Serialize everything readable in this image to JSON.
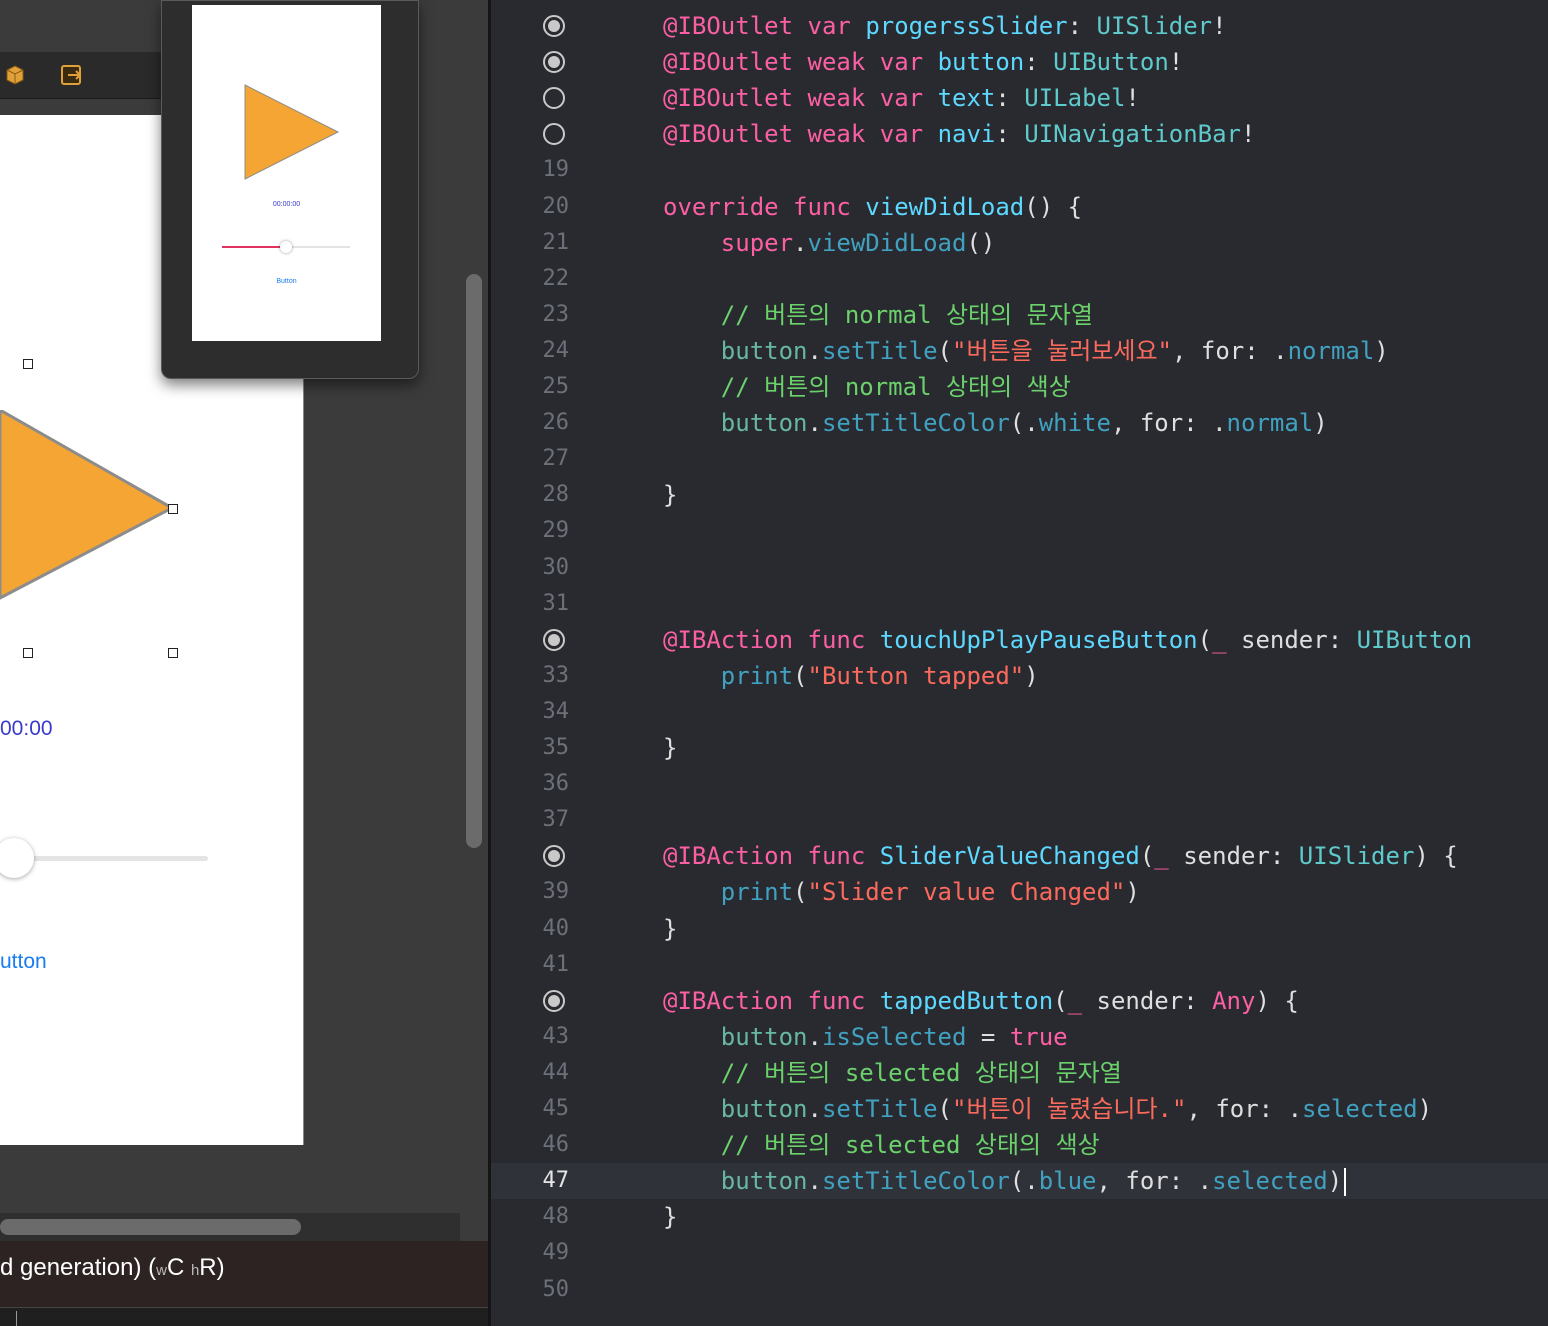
{
  "canvas": {
    "time_label": "00:00",
    "button_label": "utton",
    "mini_time": "00:00:00",
    "mini_button": "Button",
    "device_name": "d generation) (",
    "size_w_prefix": "w",
    "size_w": "C ",
    "size_h_prefix": "h",
    "size_h": "R)",
    "triangle_color": "#f4a534",
    "slider_min_color": "#e0335f",
    "slider_value": 0.5
  },
  "editor": {
    "current_line": "47",
    "lines": [
      {
        "num": "",
        "indicator": "filled",
        "tokens": [
          [
            "at",
            "@IBOutlet"
          ],
          [
            "pl",
            " "
          ],
          [
            "kw",
            "var"
          ],
          [
            "pl",
            " "
          ],
          [
            "decl",
            "progerssSlider"
          ],
          [
            "pl",
            ": "
          ],
          [
            "ty",
            "UISlider"
          ],
          [
            "pl",
            "!"
          ]
        ]
      },
      {
        "num": "",
        "indicator": "filled",
        "tokens": [
          [
            "at",
            "@IBOutlet"
          ],
          [
            "pl",
            " "
          ],
          [
            "kw",
            "weak"
          ],
          [
            "pl",
            " "
          ],
          [
            "kw",
            "var"
          ],
          [
            "pl",
            " "
          ],
          [
            "decl",
            "button"
          ],
          [
            "pl",
            ": "
          ],
          [
            "ty",
            "UIButton"
          ],
          [
            "pl",
            "!"
          ]
        ]
      },
      {
        "num": "",
        "indicator": "empty",
        "tokens": [
          [
            "at",
            "@IBOutlet"
          ],
          [
            "pl",
            " "
          ],
          [
            "kw",
            "weak"
          ],
          [
            "pl",
            " "
          ],
          [
            "kw",
            "var"
          ],
          [
            "pl",
            " "
          ],
          [
            "decl",
            "text"
          ],
          [
            "pl",
            ": "
          ],
          [
            "ty",
            "UILabel"
          ],
          [
            "pl",
            "!"
          ]
        ]
      },
      {
        "num": "",
        "indicator": "empty",
        "tokens": [
          [
            "at",
            "@IBOutlet"
          ],
          [
            "pl",
            " "
          ],
          [
            "kw",
            "weak"
          ],
          [
            "pl",
            " "
          ],
          [
            "kw",
            "var"
          ],
          [
            "pl",
            " "
          ],
          [
            "decl",
            "navi"
          ],
          [
            "pl",
            ": "
          ],
          [
            "ty",
            "UINavigationBar"
          ],
          [
            "pl",
            "!"
          ]
        ]
      },
      {
        "num": "19",
        "tokens": []
      },
      {
        "num": "20",
        "tokens": [
          [
            "kw",
            "override"
          ],
          [
            "pl",
            " "
          ],
          [
            "kw",
            "func"
          ],
          [
            "pl",
            " "
          ],
          [
            "decl",
            "viewDidLoad"
          ],
          [
            "pl",
            "() {"
          ]
        ]
      },
      {
        "num": "21",
        "tokens": [
          [
            "pl",
            "    "
          ],
          [
            "kw",
            "super"
          ],
          [
            "pl",
            "."
          ],
          [
            "fn",
            "viewDidLoad"
          ],
          [
            "pl",
            "()"
          ]
        ]
      },
      {
        "num": "22",
        "tokens": []
      },
      {
        "num": "23",
        "tokens": [
          [
            "cm",
            "    // 버튼의 normal 상태의 문자열"
          ]
        ]
      },
      {
        "num": "24",
        "tokens": [
          [
            "pl",
            "    "
          ],
          [
            "pp",
            "button"
          ],
          [
            "pl",
            "."
          ],
          [
            "fn",
            "setTitle"
          ],
          [
            "pl",
            "("
          ],
          [
            "str",
            "\"버튼을 눌러보세요\""
          ],
          [
            "pl",
            ", for: ."
          ],
          [
            "fn",
            "normal"
          ],
          [
            "pl",
            ")"
          ]
        ]
      },
      {
        "num": "25",
        "tokens": [
          [
            "cm",
            "    // 버튼의 normal 상태의 색상"
          ]
        ]
      },
      {
        "num": "26",
        "tokens": [
          [
            "pl",
            "    "
          ],
          [
            "pp",
            "button"
          ],
          [
            "pl",
            "."
          ],
          [
            "fn",
            "setTitleColor"
          ],
          [
            "pl",
            "(."
          ],
          [
            "fn",
            "white"
          ],
          [
            "pl",
            ", for: ."
          ],
          [
            "fn",
            "normal"
          ],
          [
            "pl",
            ")"
          ]
        ]
      },
      {
        "num": "27",
        "tokens": []
      },
      {
        "num": "28",
        "tokens": [
          [
            "pl",
            "}"
          ]
        ]
      },
      {
        "num": "29",
        "tokens": []
      },
      {
        "num": "30",
        "tokens": []
      },
      {
        "num": "31",
        "tokens": []
      },
      {
        "num": "",
        "indicator": "filled",
        "tokens": [
          [
            "at",
            "@IBAction"
          ],
          [
            "pl",
            " "
          ],
          [
            "kw",
            "func"
          ],
          [
            "pl",
            " "
          ],
          [
            "decl",
            "touchUpPlayPauseButton"
          ],
          [
            "pl",
            "("
          ],
          [
            "at",
            "_"
          ],
          [
            "pl",
            " sender: "
          ],
          [
            "ty",
            "UIButton"
          ]
        ]
      },
      {
        "num": "33",
        "tokens": [
          [
            "pl",
            "    "
          ],
          [
            "fn",
            "print"
          ],
          [
            "pl",
            "("
          ],
          [
            "str",
            "\"Button tapped\""
          ],
          [
            "pl",
            ")"
          ]
        ]
      },
      {
        "num": "34",
        "tokens": []
      },
      {
        "num": "35",
        "tokens": [
          [
            "pl",
            "}"
          ]
        ]
      },
      {
        "num": "36",
        "tokens": []
      },
      {
        "num": "37",
        "tokens": []
      },
      {
        "num": "",
        "indicator": "filled",
        "tokens": [
          [
            "at",
            "@IBAction"
          ],
          [
            "pl",
            " "
          ],
          [
            "kw",
            "func"
          ],
          [
            "pl",
            " "
          ],
          [
            "decl",
            "SliderValueChanged"
          ],
          [
            "pl",
            "("
          ],
          [
            "at",
            "_"
          ],
          [
            "pl",
            " sender: "
          ],
          [
            "ty",
            "UISlider"
          ],
          [
            "pl",
            ") {"
          ]
        ]
      },
      {
        "num": "39",
        "tokens": [
          [
            "pl",
            "    "
          ],
          [
            "fn",
            "print"
          ],
          [
            "pl",
            "("
          ],
          [
            "str",
            "\"Slider value Changed\""
          ],
          [
            "pl",
            ")"
          ]
        ]
      },
      {
        "num": "40",
        "tokens": [
          [
            "pl",
            "}"
          ]
        ]
      },
      {
        "num": "41",
        "tokens": []
      },
      {
        "num": "",
        "indicator": "filled",
        "tokens": [
          [
            "at",
            "@IBAction"
          ],
          [
            "pl",
            " "
          ],
          [
            "kw",
            "func"
          ],
          [
            "pl",
            " "
          ],
          [
            "decl",
            "tappedButton"
          ],
          [
            "pl",
            "("
          ],
          [
            "at",
            "_"
          ],
          [
            "pl",
            " sender: "
          ],
          [
            "any",
            "Any"
          ],
          [
            "pl",
            ") {"
          ]
        ]
      },
      {
        "num": "43",
        "tokens": [
          [
            "pl",
            "    "
          ],
          [
            "pp",
            "button"
          ],
          [
            "pl",
            "."
          ],
          [
            "fn",
            "isSelected"
          ],
          [
            "pl",
            " = "
          ],
          [
            "kw",
            "true"
          ]
        ]
      },
      {
        "num": "44",
        "tokens": [
          [
            "cm",
            "    // 버튼의 selected 상태의 문자열"
          ]
        ]
      },
      {
        "num": "45",
        "tokens": [
          [
            "pl",
            "    "
          ],
          [
            "pp",
            "button"
          ],
          [
            "pl",
            "."
          ],
          [
            "fn",
            "setTitle"
          ],
          [
            "pl",
            "("
          ],
          [
            "str",
            "\"버튼이 눌렸습니다.\""
          ],
          [
            "pl",
            ", for: ."
          ],
          [
            "fn",
            "selected"
          ],
          [
            "pl",
            ")"
          ]
        ]
      },
      {
        "num": "46",
        "tokens": [
          [
            "cm",
            "    // 버튼의 selected 상태의 색상"
          ]
        ]
      },
      {
        "num": "47",
        "tokens": [
          [
            "pl",
            "    "
          ],
          [
            "pp",
            "button"
          ],
          [
            "pl",
            "."
          ],
          [
            "fn",
            "setTitleColor"
          ],
          [
            "pl",
            "(."
          ],
          [
            "fn",
            "blue"
          ],
          [
            "pl",
            ", for: ."
          ],
          [
            "fn",
            "selected"
          ],
          [
            "pl",
            ")"
          ]
        ]
      },
      {
        "num": "48",
        "tokens": [
          [
            "pl",
            "}"
          ]
        ]
      },
      {
        "num": "49",
        "tokens": []
      },
      {
        "num": "50",
        "tokens": []
      },
      {
        "num": "",
        "tokens": []
      }
    ]
  }
}
